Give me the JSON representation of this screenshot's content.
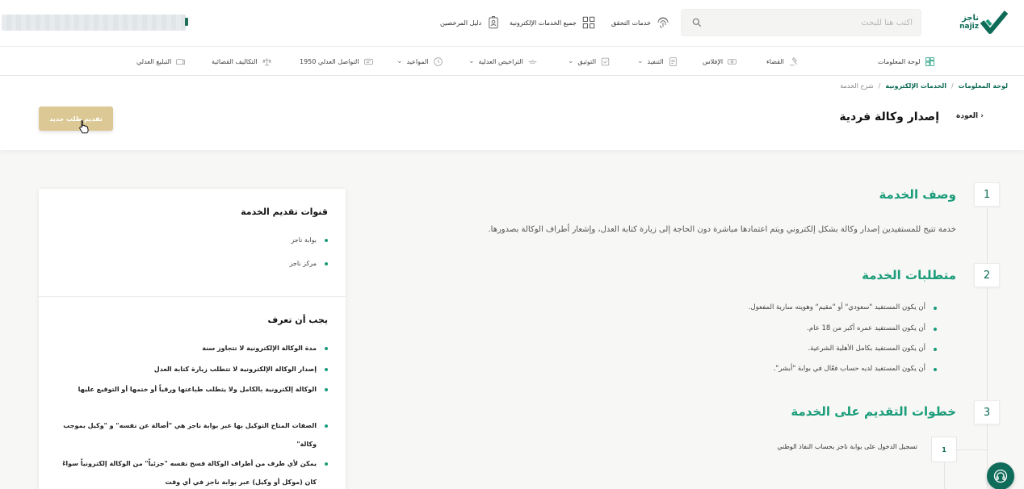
{
  "header": {
    "logo": {
      "name": "ناجز",
      "latin": "najiz"
    },
    "search": {
      "placeholder": "اكتب هنا للبحث"
    },
    "links": [
      {
        "label": "خدمات التحقق",
        "icon": "fingerprint-icon"
      },
      {
        "label": "جميع الخدمات الإلكترونية",
        "icon": "grid-icon"
      },
      {
        "label": "دليل المرخصين",
        "icon": "id-badge-icon"
      }
    ]
  },
  "nav": {
    "items": [
      {
        "label": "لوحة المعلومات",
        "icon": "dashboard-icon",
        "dropdown": false
      },
      {
        "label": "القضاء",
        "icon": "gavel-icon",
        "dropdown": false
      },
      {
        "label": "الإفلاس",
        "icon": "money-icon",
        "dropdown": false
      },
      {
        "label": "التنفيذ",
        "icon": "document-icon",
        "dropdown": true
      },
      {
        "label": "التوثيق",
        "icon": "stamp-icon",
        "dropdown": true
      },
      {
        "label": "التراخيص العدلية",
        "icon": "license-icon",
        "dropdown": true
      },
      {
        "label": "المواعيد",
        "icon": "clock-icon",
        "dropdown": true
      },
      {
        "label": "التواصل العدلي 1950",
        "icon": "chat-icon",
        "dropdown": false
      },
      {
        "label": "التكاليف القضائية",
        "icon": "scales-icon",
        "dropdown": false
      },
      {
        "label": "التبليغ العدلي",
        "icon": "notify-icon",
        "dropdown": false
      }
    ]
  },
  "breadcrumb": {
    "items": [
      "لوحة المعلومات",
      "الخدمات الإلكترونية"
    ],
    "separator": "/",
    "current": "شرح الخدمة"
  },
  "page": {
    "back_label": "العودة",
    "title": "إصدار وكالة فردية",
    "new_request_label": "تقديم طلب جديد"
  },
  "channels": {
    "title": "قنوات تقديم الخدمة",
    "items": [
      "بوابة ناجز",
      "مركز ناجز"
    ]
  },
  "know": {
    "title": "يجب أن تعرف",
    "items": [
      "مدة الوكالة الإلكترونية لا تتجاوز سنة",
      "إصدار الوكالة الإلكترونية لا تتطلب زيارة كتابة العدل",
      "الوكالة إلكترونية بالكامل ولا يتطلب طباعتها ورقياً أو ختمها أو التوقيع عليها",
      "الصفات المتاح التوكيل بها عبر بوابة ناجز هي \"أصالة عن نفسه\" و \"وكيل بموجب وكالة\"",
      "يمكن لأي طرف من أطراف الوكالة فسخ نفسه \"جزئياً\" من الوكالة إلكترونياً سواءً كان (موكل أو وكيل) عبر بوابة ناجز في أي وقت"
    ]
  },
  "sections": {
    "description": {
      "number": "1",
      "title": "وصف الخدمة",
      "text": "خدمة تتيح للمستفيدين إصدار وكالة بشكل إلكتروني ويتم اعتمادها مباشرة دون الحاجة إلى زيارة كتابة العدل، وإشعار أطراف الوكالة بصدورها."
    },
    "requirements": {
      "number": "2",
      "title": "متطلبات الخدمة",
      "items": [
        "أن يكون المستفيد \"سعودي\" أو \"مقيم\" وهويته سارية المفعول.",
        "أن يكون المستفيد عمره أكبر من 18 عام.",
        "أن يكون المستفيد بكامل الأهلية الشرعية.",
        "أن يكون المستفيد لديه حساب فعّال في بوابة \"أبشر\"."
      ]
    },
    "steps": {
      "number": "3",
      "title": "خطوات التقديم على الخدمة",
      "items": [
        {
          "number": "1",
          "text": "تسجيل الدخول على بوابة ناجز بحساب النفاذ الوطني"
        }
      ]
    }
  },
  "colors": {
    "brand_green": "#0e6b56",
    "accent_green": "#1a9c7a",
    "button_gold": "#dcc894"
  }
}
